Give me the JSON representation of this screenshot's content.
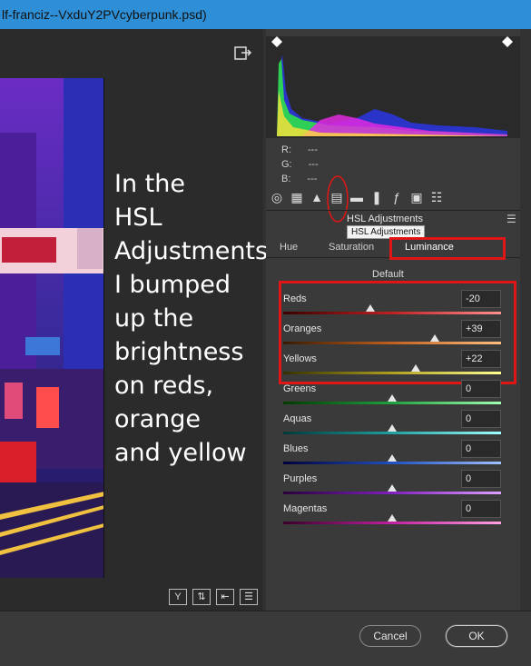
{
  "window": {
    "title": "lf-franciz--VxduY2PVcyberpunk.psd)"
  },
  "annotation": {
    "lines": [
      "In the",
      "HSL",
      "Adjustments",
      "I bumped",
      "up the",
      "brightness",
      "on reds,",
      "orange",
      "and yellow"
    ]
  },
  "readout": {
    "r_label": "R:",
    "r_value": "---",
    "g_label": "G:",
    "g_value": "---",
    "b_label": "B:",
    "b_value": "---"
  },
  "toolbar_icons": [
    "basic-icon",
    "tone-curve-icon",
    "detail-icon",
    "hsl-icon",
    "split-toning-icon",
    "lens-corrections-icon",
    "effects-icon",
    "camera-calibration-icon",
    "presets-icon"
  ],
  "panel": {
    "title": "HSL Adjustments",
    "tooltip": "HSL Adjustments",
    "tabs": [
      "Hue",
      "Saturation",
      "Luminance"
    ],
    "active_tab": "Luminance",
    "default_label": "Default"
  },
  "sliders": [
    {
      "label": "Reds",
      "value": "-20"
    },
    {
      "label": "Oranges",
      "value": "+39"
    },
    {
      "label": "Yellows",
      "value": "+22"
    },
    {
      "label": "Greens",
      "value": "0"
    },
    {
      "label": "Aquas",
      "value": "0"
    },
    {
      "label": "Blues",
      "value": "0"
    },
    {
      "label": "Purples",
      "value": "0"
    },
    {
      "label": "Magentas",
      "value": "0"
    }
  ],
  "bottom_tools": [
    "Y"
  ],
  "buttons": {
    "cancel": "Cancel",
    "ok": "OK"
  },
  "colors": {
    "highlight": "#e01515",
    "titlebar": "#2e8fd6"
  }
}
